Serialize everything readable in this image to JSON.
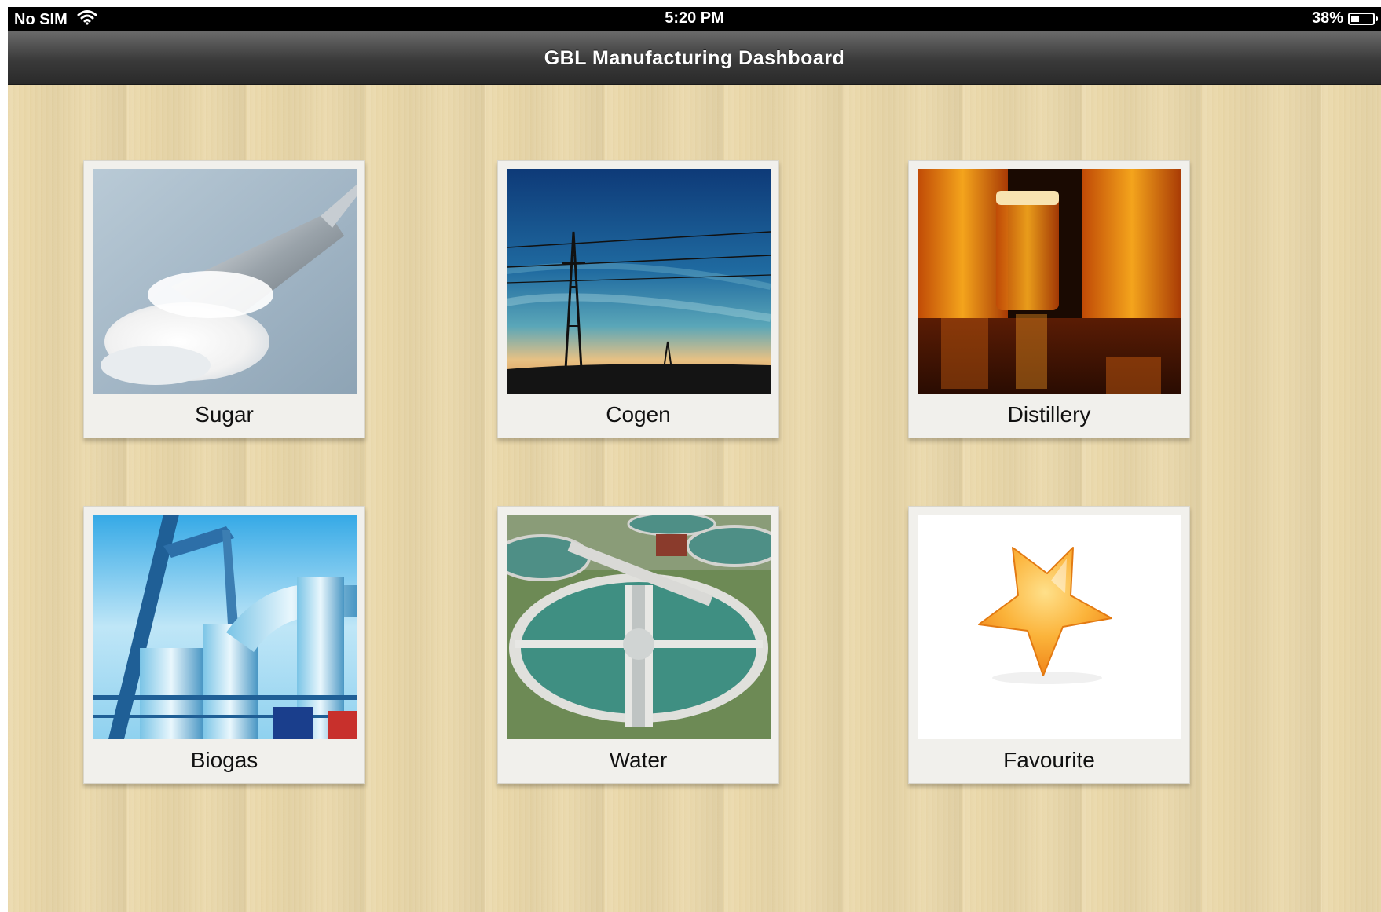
{
  "status_bar": {
    "carrier": "No SIM",
    "wifi_icon": "wifi-icon",
    "time": "5:20 PM",
    "battery_percent": "38%",
    "battery_level": 0.38
  },
  "nav_bar": {
    "title": "GBL Manufacturing Dashboard"
  },
  "tiles": [
    {
      "label": "Sugar",
      "image": "sugar-scoop-image"
    },
    {
      "label": "Cogen",
      "image": "power-lines-sunset-image"
    },
    {
      "label": "Distillery",
      "image": "beer-glasses-image"
    },
    {
      "label": "Biogas",
      "image": "industrial-pipes-image"
    },
    {
      "label": "Water",
      "image": "water-treatment-plant-image"
    },
    {
      "label": "Favourite",
      "image": "star-icon"
    }
  ]
}
